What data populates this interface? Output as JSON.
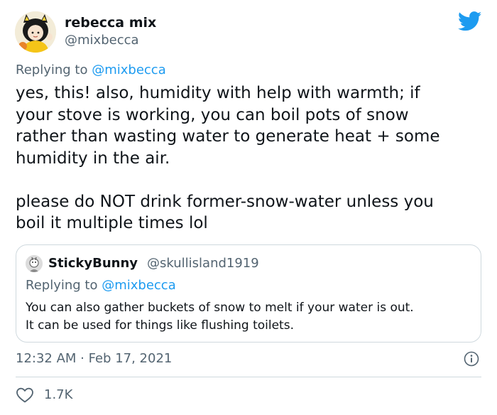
{
  "author": {
    "display_name": "rebecca mix",
    "handle": "@mixbecca",
    "avatar": "cartoon-avatar"
  },
  "reply_context": {
    "prefix": "Replying to",
    "handle": "@mixbecca"
  },
  "tweet_text": "yes, this! also, humidity with help with warmth; if\nyour stove is working, you can boil pots of snow\nrather than wasting water to generate heat + some\nhumidity in the air.\n\nplease do NOT drink former-snow-water unless you\nboil it multiple times lol",
  "quoted_tweet": {
    "display_name": "StickyBunny",
    "handle": "@skullisland1919",
    "reply_prefix": "Replying to",
    "reply_handle": "@mixbecca",
    "text": "You can also gather buckets of snow to melt if your water is out.\nIt can be used for things like flushing toilets."
  },
  "meta": {
    "timestamp": "12:32 AM · Feb 17, 2021"
  },
  "engagement": {
    "likes": "1.7K"
  },
  "icons": {
    "brand": "twitter-bird-icon",
    "info": "info-icon",
    "like": "heart-icon"
  },
  "colors": {
    "brand_blue": "#1d9bf0",
    "text_primary": "#0f1419",
    "text_secondary": "#536471",
    "border": "#cfd9de"
  }
}
